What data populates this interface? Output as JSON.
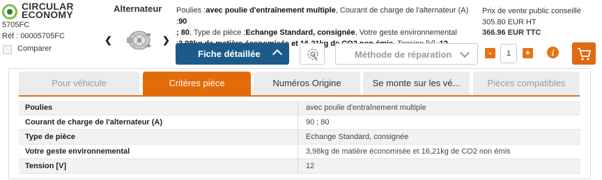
{
  "brand": {
    "line1": "CIRCULAR",
    "line2": "ECONOMY"
  },
  "product": {
    "ref_short": "5705FC",
    "ref_full": "Réf : 00005705FC",
    "compare_label": "Comparer",
    "title": "Alternateur"
  },
  "description": {
    "l1a": "Poulies :",
    "l1b": "avec poulie d'entraînement multiple",
    "l1c": ", Courant de charge de l'alternateur (A) :",
    "l1d": "90",
    "l2a": "; 80",
    "l2b": ", Type de pièce :",
    "l2c": "Echange Standard, consignée",
    "l2d": ", Votre geste environnemental",
    "l3a": ":",
    "l3b": "3,98kg de matière économisée et 16,21kg de CO2 non émis",
    "l3c": ", Tension [V] :",
    "l3d": "12"
  },
  "price": {
    "label": "Prix de vente public conseillé",
    "ht": "305.80 EUR HT",
    "ttc": "366.96 EUR TTC"
  },
  "actions": {
    "fiche_label": "Fiche détaillée",
    "method_placeholder": "Méthode de réparation",
    "qty_minus": "-",
    "qty_value": "1",
    "qty_plus": "+",
    "info": "i"
  },
  "tabs": [
    {
      "label": "Pour véhicule"
    },
    {
      "label": "Critères pièce"
    },
    {
      "label": "Numéros Origine"
    },
    {
      "label": "Se monte sur les vé..."
    },
    {
      "label": "Pièces compatibles"
    }
  ],
  "criteria": [
    {
      "key": "Poulies",
      "value": "avec poulie d'entraînement multiple"
    },
    {
      "key": "Courant de charge de l'alternateur (A)",
      "value": "90 ; 80"
    },
    {
      "key": "Type de pièce",
      "value": "Echange Standard, consignée"
    },
    {
      "key": "Votre geste environnemental",
      "value": "3,98kg de matière économisée et 16,21kg de CO2 non émis"
    },
    {
      "key": "Tension [V]",
      "value": "12"
    }
  ],
  "colors": {
    "accent": "#e36c0a",
    "primary": "#1b5a8b",
    "brand_green": "#7cbf3f"
  }
}
